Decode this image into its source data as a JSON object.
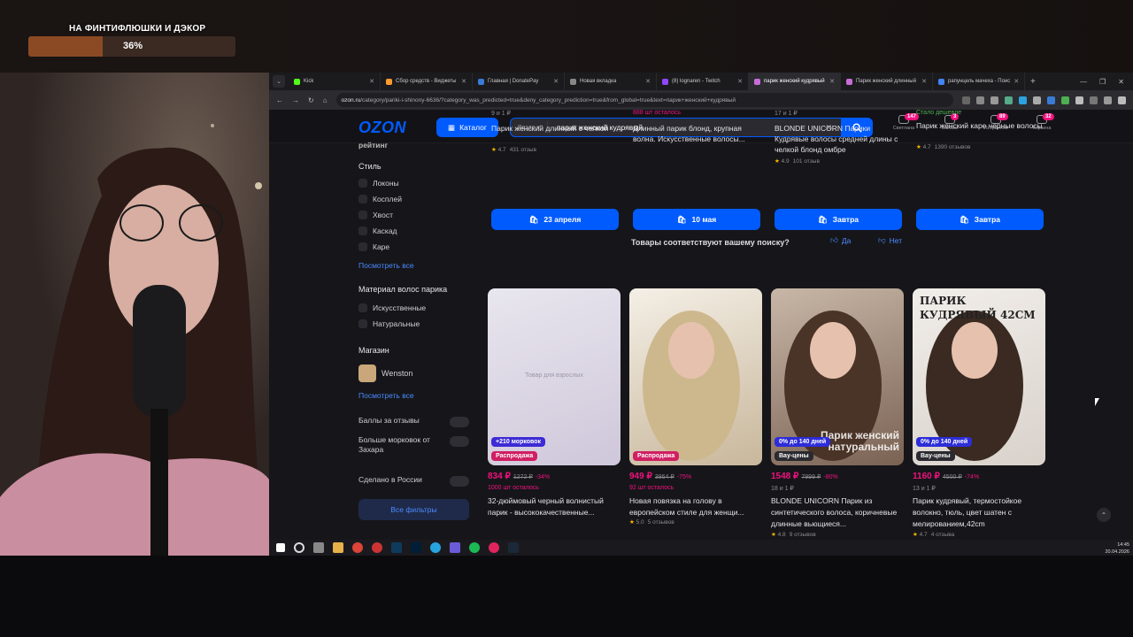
{
  "stream": {
    "goal_title": "НА ФИНТИФЛЮШКИ И ДЭКОР",
    "goal_percent_label": "36%",
    "goal_progress": 0.36
  },
  "browser": {
    "tabs": [
      {
        "label": "Kick",
        "color": "#53fc18"
      },
      {
        "label": "Сбор средств - Виджеты",
        "color": "#ff9a2e"
      },
      {
        "label": "Главная | DonatePay",
        "color": "#3a7bd5"
      },
      {
        "label": "Новая вкладка",
        "color": "#888888"
      },
      {
        "label": "(8) lognaren - Twitch",
        "color": "#9146ff"
      },
      {
        "label": "парик женский кудрявый",
        "color": "#c86dd7"
      },
      {
        "label": "Парик женский длинный",
        "color": "#c86dd7"
      },
      {
        "label": "рапунцель мачеха - Поис",
        "color": "#4285f4"
      }
    ],
    "url_host": "ozon.ru",
    "url_path": "/category/pariki-i-shinony-6636/?category_was_predicted=true&deny_category_prediction=true&from_global=true&text=парик+женский+кудрявый"
  },
  "ozon": {
    "logo": "OZON",
    "catalog_label": "Каталог",
    "search_scope": "Везде",
    "search_value": "парик женский кудрявый",
    "header_icons": [
      {
        "label": "Светлана",
        "badge": "147"
      },
      {
        "label": "Заказы",
        "badge": "3"
      },
      {
        "label": "Избранное",
        "badge": "89"
      },
      {
        "label": "Корзина",
        "badge": "32"
      }
    ],
    "sidebar": {
      "rating_label": "рейтинг",
      "style_heading": "Стиль",
      "style_items": [
        "Локоны",
        "Косплей",
        "Хвост",
        "Каскад",
        "Каре"
      ],
      "style_more": "Посмотреть все",
      "material_heading": "Материал волос парика",
      "material_items": [
        "Искусственные",
        "Натуральные"
      ],
      "shop_heading": "Магазин",
      "shop_item": "Wenston",
      "shop_more": "Посмотреть все",
      "toggles": [
        "Баллы за отзывы",
        "Больше морковок от Захара",
        "Сделано в России"
      ],
      "all_filters": "Все фильтры"
    },
    "top_products": [
      {
        "meta": "9 и 1 ₽",
        "title": "Парик женский длинный с челкой",
        "rating": "4.7",
        "reviews": "431 отзыв",
        "delivery": "23 апреля"
      },
      {
        "meta": "888 шт осталось",
        "title": "Длинный парик блонд, крупная волна. Искусственные волосы...",
        "rating": "",
        "reviews": "",
        "delivery": "10 мая"
      },
      {
        "meta": "17 и 1 ₽",
        "title": "BLONDE UNICORN Парики Кудрявые волосы средней длины с челкой блонд омбре",
        "rating": "4.9",
        "reviews": "101 отзыв",
        "delivery": "Завтра"
      },
      {
        "meta": "Стало дешевле",
        "title": "Парик женский каре черные волосы",
        "rating": "4.7",
        "reviews": "1390 отзывов",
        "delivery": "Завтра"
      }
    ],
    "feedback": {
      "question": "Товары соответствуют вашему поиску?",
      "yes": "Да",
      "no": "Нет"
    },
    "products": [
      {
        "tag1": "+210 морковок",
        "tag2": "Распродажа",
        "overlay": "Товар для взрослых",
        "price": "834 ₽",
        "old": "1272 ₽",
        "disc": "-34%",
        "meta": "1000 шт осталось",
        "title": "32-дюймовый черный волнистый парик - высококачественные...",
        "rating": "",
        "reviews": ""
      },
      {
        "tag1": "",
        "tag2": "Распродажа",
        "overlay": "",
        "price": "949 ₽",
        "old": "3864 ₽",
        "disc": "-75%",
        "meta": "92 шт осталось",
        "title": "Новая повязка на голову в европейском стиле для женщи...",
        "rating": "5.0",
        "reviews": "5 отзывов"
      },
      {
        "tag1": "0% до 140 дней",
        "tag2": "Вау-цены",
        "overlay": "Парик женский натуральный",
        "price": "1548 ₽",
        "old": "7999 ₽",
        "disc": "-80%",
        "meta": "18 и 1 ₽",
        "title": "BLONDE UNICORN Парик из синтетического волоса, коричневые длинные вьющиеся...",
        "rating": "4.8",
        "reviews": "9 отзывов"
      },
      {
        "tag1": "0% до 140 дней",
        "tag2": "Вау-цены",
        "overlay": "ПАРИК КУДРЯВЫЙ 42СМ",
        "price": "1160 ₽",
        "old": "4500 ₽",
        "disc": "-74%",
        "meta": "13 и 1 ₽",
        "title": "Парик кудрявый, термостойкое волокно, тюль, цвет шатен с мелированием,42cm",
        "rating": "4.7",
        "reviews": "4 отзыва"
      }
    ]
  },
  "taskbar": {
    "time": "14:45",
    "date": "20.04.2026"
  }
}
